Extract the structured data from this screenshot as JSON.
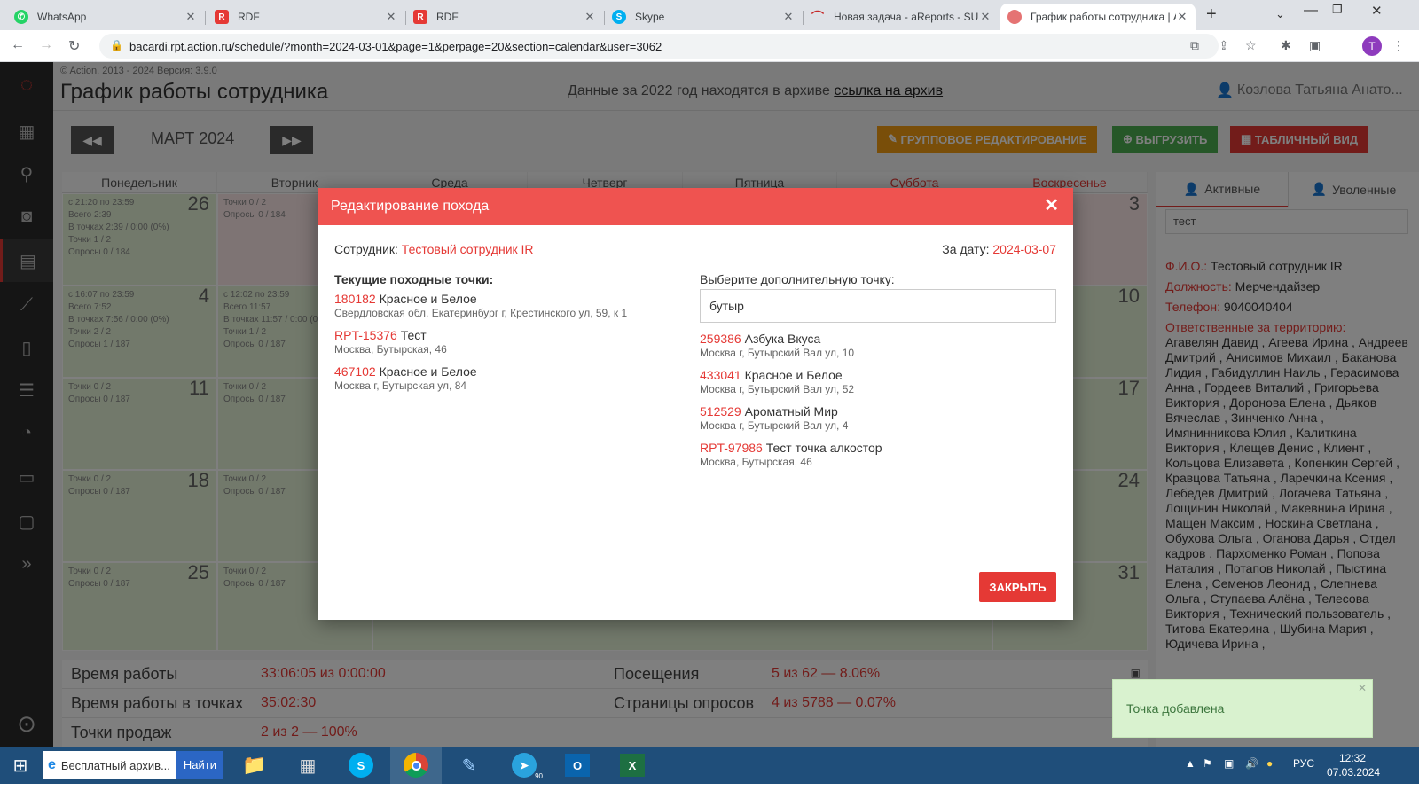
{
  "browser": {
    "tabs": [
      {
        "title": "WhatsApp",
        "icon": "whatsapp-icon",
        "color": "#25d366"
      },
      {
        "title": "RDF",
        "icon": "rdf-icon",
        "color": "#e53935"
      },
      {
        "title": "RDF",
        "icon": "rdf-icon",
        "color": "#e53935"
      },
      {
        "title": "Skype",
        "icon": "skype-icon",
        "color": "#00aff0"
      },
      {
        "title": "Новая задача - aReports - SU",
        "icon": "areports-icon",
        "color": "#c62828"
      },
      {
        "title": "График работы сотрудника | A",
        "icon": "chart-pie-icon",
        "color": "#e57373"
      }
    ],
    "url": "bacardi.rpt.action.ru/schedule/?month=2024-03-01&page=1&perpage=20&section=calendar&user=3062",
    "avatar": "T"
  },
  "header": {
    "meta": "© Action. 2013 - 2024   Версия: 3.9.0",
    "title": "График работы сотрудника",
    "archive_text": "Данные за 2022 год находятся в архиве",
    "archive_link": "ссылка на архив",
    "user": "Козлова Татьяна Анато..."
  },
  "toolbar": {
    "month": "МАРТ 2024",
    "group_edit": "ГРУППОВОЕ РЕДАКТИРОВАНИЕ",
    "export": "ВЫГРУЗИТЬ",
    "table_view": "ТАБЛИЧНЫЙ ВИД"
  },
  "calendar": {
    "days": [
      "Понедельник",
      "Вторник",
      "Среда",
      "Четверг",
      "Пятница",
      "Суббота",
      "Воскресенье"
    ],
    "cells": [
      {
        "day": "26",
        "text": [
          "с 21:20 по 23:59",
          "Всего 2:39",
          "В точках 2:39 / 0:00 (0%)",
          "Точки 1 / 2",
          "Опросы 0 / 184"
        ]
      },
      {
        "day": "",
        "text": [
          "Точки 0 / 2",
          "Опросы 0 / 184"
        ]
      },
      {
        "day": "3",
        "text": []
      },
      {
        "day": "4",
        "text": [
          "с 16:07 по 23:59",
          "Всего 7:52",
          "В точках 7:56 / 0:00 (0%)",
          "Точки 2 / 2",
          "Опросы 1 / 187"
        ]
      },
      {
        "day": "",
        "text": [
          "с 12:02 по 23:59",
          "Всего 11:57",
          "В точках 11:57 / 0:00 (0%)",
          "Точки 1 / 2",
          "Опросы 0 / 187"
        ]
      },
      {
        "day": "10",
        "text": []
      },
      {
        "day": "11",
        "text": [
          "Точки 0 / 2",
          "Опросы 0 / 187"
        ]
      },
      {
        "day": "",
        "text": [
          "Точки 0 / 2",
          "Опросы 0 / 187"
        ]
      },
      {
        "day": "17",
        "text": []
      },
      {
        "day": "18",
        "text": [
          "Точки 0 / 2",
          "Опросы 0 / 187"
        ]
      },
      {
        "day": "",
        "text": [
          "Точки 0 / 2",
          "Опросы 0 / 187"
        ]
      },
      {
        "day": "24",
        "text": []
      },
      {
        "day": "25",
        "text": [
          "Точки 0 / 2",
          "Опросы 0 / 187"
        ]
      },
      {
        "day": "",
        "text": [
          "Точки 0 / 2",
          "Опросы 0 / 187"
        ]
      },
      {
        "day": "31",
        "text": []
      }
    ]
  },
  "stats": {
    "rows": [
      {
        "l1": "Время работы",
        "v1": "33:06:05 из 0:00:00",
        "l2": "Посещения",
        "v2": "5 из 62 — 8.06%"
      },
      {
        "l1": "Время работы в точках",
        "v1": "35:02:30",
        "l2": "Страницы опросов",
        "v2": "4 из 5788 — 0.07%"
      },
      {
        "l1": "Точки продаж",
        "v1": "2 из 2 — 100%",
        "l2": "",
        "v2": ""
      }
    ]
  },
  "right_panel": {
    "tab_active": "Активные",
    "tab_fired": "Уволенные",
    "search": "тест",
    "fio_label": "Ф.И.О.:",
    "fio": "Тестовый сотрудник IR",
    "role_label": "Должность:",
    "role": "Мерчендайзер",
    "phone_label": "Телефон:",
    "phone": "9040040404",
    "resp_label": "Ответственные за территорию:",
    "resp": "Агавелян Давид , Агеева Ирина , Андреев Дмитрий , Анисимов Михаил , Баканова Лидия , Габидуллин Наиль , Герасимова Анна , Гордеев Виталий , Григорьева Виктория , Доронова Елена , Дьяков Вячеслав , Зинченко Анна , Имянинникова Юлия , Калиткина Виктория , Клещев Денис , Клиент , Кольцова Елизавета , Копенкин Сергей , Кравцова Татьяна , Ларечкина Ксения , Лебедев Дмитрий , Логачева Татьяна , Лощинин Николай , Макевнина Ирина , Мащен Максим , Носкина Светлана , Обухова Ольга , Оганова Дарья , Отдел кадров , Пархоменко Роман , Попова Наталия , Потапов Николай , Пыстина Елена , Семенов Леонид , Слепнева Ольга , Ступаева Алёна , Телесова Виктория , Технический пользователь , Титова Екатерина , Шубина Мария , Юдичева Ирина ,"
  },
  "modal": {
    "title": "Редактирование похода",
    "employee_label": "Сотрудник:",
    "employee": "Тестовый сотрудник IR",
    "date_label": "За дату:",
    "date": "2024-03-07",
    "current_label": "Текущие походные точки:",
    "current": [
      {
        "code": "180182",
        "name": "Красное и Белое",
        "addr": "Свердловская обл, Екатеринбург г, Крестинского ул, 59, к 1"
      },
      {
        "code": "RPT-15376",
        "name": "Тест",
        "addr": "Москва, Бутырская, 46"
      },
      {
        "code": "467102",
        "name": "Красное и Белое",
        "addr": "Москва г, Бутырская ул, 84"
      }
    ],
    "extra_label": "Выберите дополнительную точку:",
    "search": "бутыр",
    "results": [
      {
        "code": "259386",
        "name": "Азбука Вкуса",
        "addr": "Москва г, Бутырский Вал ул, 10"
      },
      {
        "code": "433041",
        "name": "Красное и Белое",
        "addr": "Москва г, Бутырский Вал ул, 52"
      },
      {
        "code": "512529",
        "name": "Ароматный Мир",
        "addr": "Москва г, Бутырский Вал ул, 4"
      },
      {
        "code": "RPT-97986",
        "name": "Тест точка алкостор",
        "addr": "Москва, Бутырская, 46"
      }
    ],
    "close": "ЗАКРЫТЬ"
  },
  "toast": {
    "text": "Точка добавлена"
  },
  "taskbar": {
    "search_text": "Бесплатный архив...",
    "search_btn": "Найти",
    "lang": "РУС",
    "time": "12:32",
    "date": "07.03.2024",
    "telegram_badge": "90"
  }
}
